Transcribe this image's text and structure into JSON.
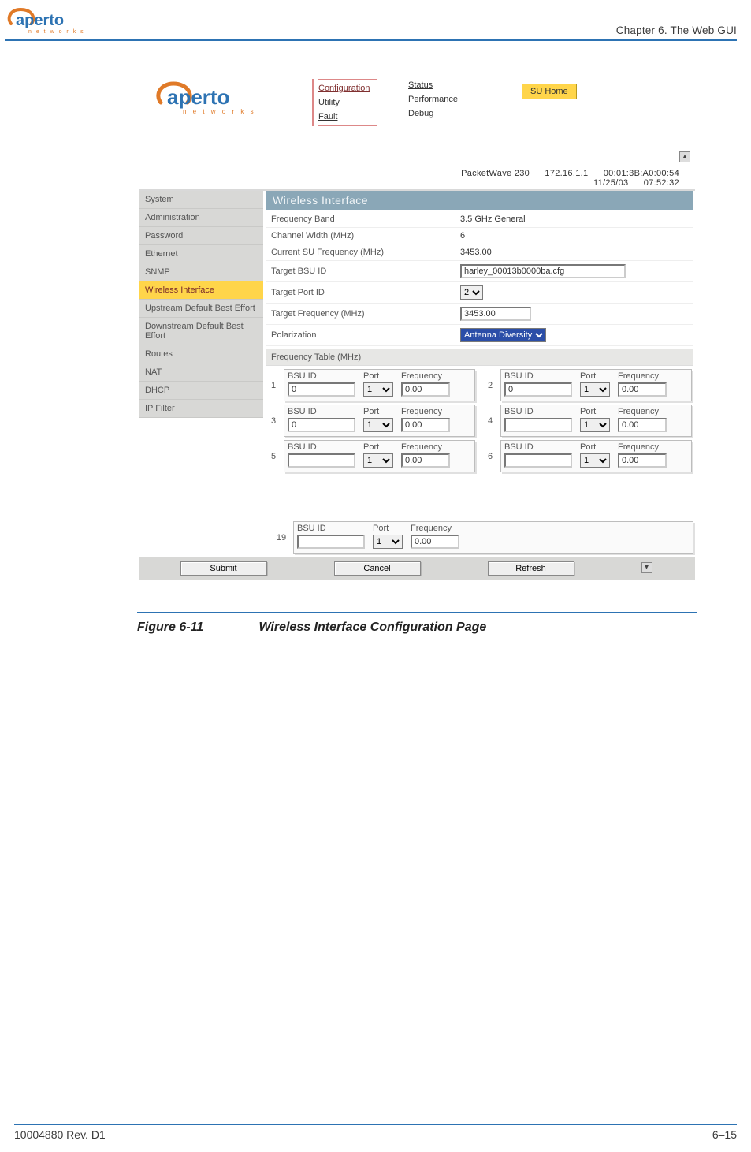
{
  "doc": {
    "chapter": "Chapter 6.  The Web GUI",
    "footer_left": "10004880 Rev. D1",
    "footer_right": "6–15",
    "figure_no": "Figure 6-11",
    "figure_title": "Wireless Interface Configuration Page"
  },
  "app": {
    "nav": {
      "col1": [
        "Configuration",
        "Utility",
        "Fault"
      ],
      "col2": [
        "Status",
        "Performance",
        "Debug"
      ],
      "su_home": "SU Home"
    },
    "status_line": {
      "device": "PacketWave 230",
      "ip": "172.16.1.1",
      "mac": "00:01:3B:A0:00:54",
      "date": "11/25/03",
      "time": "07:52:32"
    },
    "sidebar": [
      "System",
      "Administration",
      "Password",
      "Ethernet",
      "SNMP",
      "Wireless Interface",
      "Upstream Default Best Effort",
      "Downstream Default Best Effort",
      "Routes",
      "NAT",
      "DHCP",
      "IP Filter"
    ],
    "sidebar_active_index": 5,
    "panel_title": "Wireless Interface",
    "fields": {
      "freq_band": {
        "label": "Frequency Band",
        "value": "3.5 GHz General"
      },
      "chan_width": {
        "label": "Channel Width (MHz)",
        "value": "6"
      },
      "cur_su_freq": {
        "label": "Current SU Frequency (MHz)",
        "value": "3453.00"
      },
      "target_bsu": {
        "label": "Target BSU ID",
        "value": "harley_00013b0000ba.cfg"
      },
      "target_port": {
        "label": "Target Port ID",
        "value": "2"
      },
      "target_freq": {
        "label": "Target Frequency (MHz)",
        "value": "3453.00"
      },
      "polarization": {
        "label": "Polarization",
        "value": "Antenna Diversity"
      }
    },
    "freq_table_header": "Frequency Table (MHz)",
    "card_headers": {
      "bsu": "BSU ID",
      "port": "Port",
      "freq": "Frequency"
    },
    "freq_table": [
      {
        "n": "1",
        "bsu": "0",
        "port": "1",
        "freq": "0.00"
      },
      {
        "n": "2",
        "bsu": "0",
        "port": "1",
        "freq": "0.00"
      },
      {
        "n": "3",
        "bsu": "0",
        "port": "1",
        "freq": "0.00"
      },
      {
        "n": "4",
        "bsu": "",
        "port": "1",
        "freq": "0.00"
      },
      {
        "n": "5",
        "bsu": "",
        "port": "1",
        "freq": "0.00"
      },
      {
        "n": "6",
        "bsu": "",
        "port": "1",
        "freq": "0.00"
      }
    ],
    "extra_row": {
      "n": "19",
      "bsu": "",
      "port": "1",
      "freq": "0.00"
    },
    "buttons": {
      "submit": "Submit",
      "cancel": "Cancel",
      "refresh": "Refresh"
    }
  }
}
